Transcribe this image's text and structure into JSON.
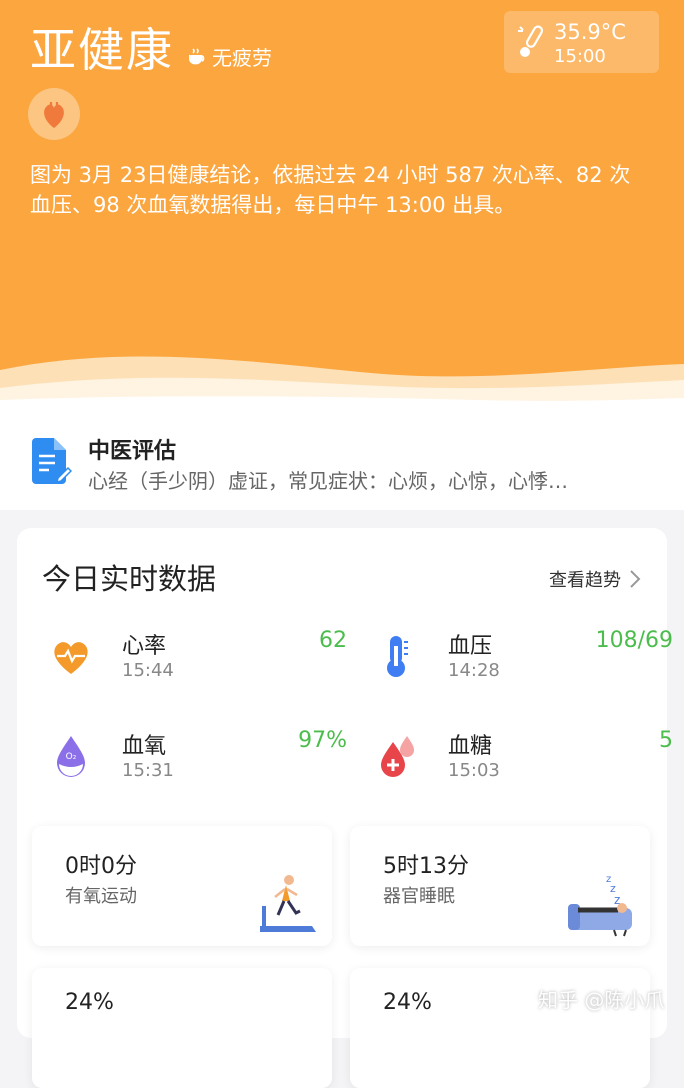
{
  "header": {
    "status": "亚健康",
    "fatigue_label": "无疲劳",
    "temperature": "35.9°C",
    "temperature_time": "15:00",
    "conclusion": "图为 3月 23日健康结论，依据过去 24 小时 587 次心率、82 次血压、98 次血氧数据得出，每日中午 13:00 出具。",
    "accent_color": "#fba63f"
  },
  "tcm": {
    "title": "中医评估",
    "description": "心经（手少阴）虚证，常见症状：心烦，心惊，心悸…"
  },
  "realtime": {
    "title": "今日实时数据",
    "trend_link": "查看趋势",
    "metrics": [
      {
        "label": "心率",
        "time": "15:44",
        "value": "62",
        "icon": "heart-rate-icon"
      },
      {
        "label": "血压",
        "time": "14:28",
        "value": "108/69",
        "icon": "thermometer-icon"
      },
      {
        "label": "血氧",
        "time": "15:31",
        "value": "97%",
        "icon": "oxygen-drop-icon"
      },
      {
        "label": "血糖",
        "time": "15:03",
        "value": "5",
        "icon": "blood-drop-icon"
      }
    ],
    "value_color": "#4cbd4c",
    "tiles": [
      {
        "value": "0时0分",
        "label": "有氧运动",
        "icon": "treadmill-icon"
      },
      {
        "value": "5时13分",
        "label": "器官睡眠",
        "icon": "sleeping-person-icon"
      },
      {
        "value": "24%",
        "label": ""
      },
      {
        "value": "24%",
        "label": ""
      }
    ]
  },
  "watermark": "知乎 @陈小爪"
}
